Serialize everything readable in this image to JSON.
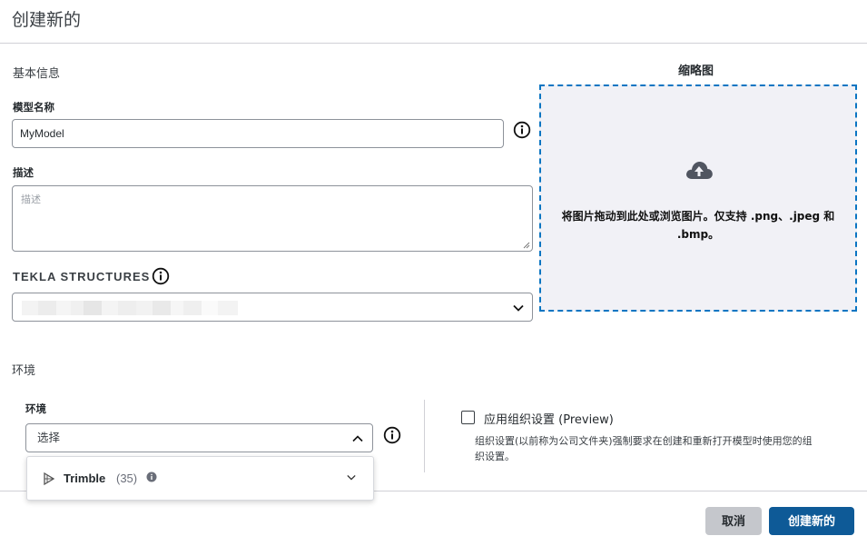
{
  "dialog": {
    "title": "创建新的"
  },
  "basic_info": {
    "section_title": "基本信息",
    "model_name_label": "模型名称",
    "model_name_value": "MyModel",
    "description_label": "描述",
    "description_placeholder": "描述",
    "tekla_label": "TEKLA STRUCTURES"
  },
  "thumbnail": {
    "title": "缩略图",
    "dropzone_text": "将图片拖动到此处或浏览图片。仅支持 .png、.jpeg 和 .bmp。",
    "icon": "cloud-upload-icon"
  },
  "environment": {
    "section_title": "环境",
    "field_label": "环境",
    "select_placeholder": "选择",
    "options": [
      {
        "label": "Trimble",
        "count": "(35)",
        "icon": "trimble-logo"
      }
    ],
    "org_settings_label": "应用组织设置 (Preview)",
    "org_settings_help": "组织设置(以前称为公司文件夹)强制要求在创建和重新打开模型时使用您的组织设置。"
  },
  "footer": {
    "cancel_label": "取消",
    "create_label": "创建新的"
  },
  "colors": {
    "primary": "#0e5a97",
    "dropzone_border": "#0a75c2",
    "dropzone_bg": "#f1f1f6",
    "cancel_bg": "#c5c7cc"
  }
}
